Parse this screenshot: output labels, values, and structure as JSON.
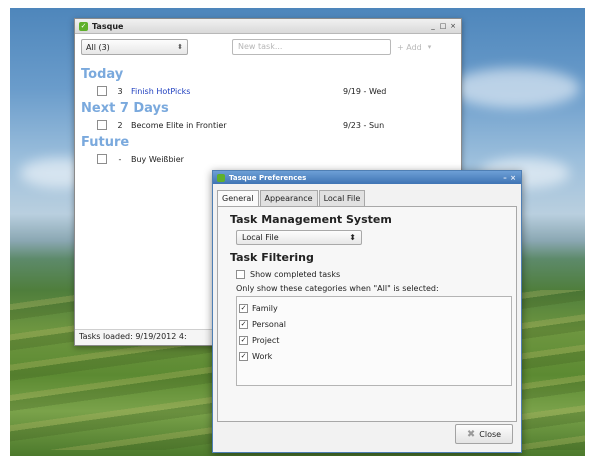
{
  "main_window": {
    "title": "Tasque",
    "controls": [
      "_",
      "□",
      "×"
    ],
    "filter_combo": "All (3)",
    "new_task_placeholder": "New task...",
    "add_label": "+ Add",
    "status": "Tasks loaded: 9/19/2012 4:"
  },
  "sections": [
    {
      "name": "Today",
      "tasks": [
        {
          "prio": "3",
          "name": "Finish HotPicks",
          "date": "9/19 - Wed"
        }
      ]
    },
    {
      "name": "Next 7 Days",
      "tasks": [
        {
          "prio": "2",
          "name": "Become Elite in Frontier",
          "date": "9/23 - Sun"
        }
      ]
    },
    {
      "name": "Future",
      "tasks": [
        {
          "prio": "-",
          "name": "Buy Weißbier",
          "date": ""
        }
      ]
    }
  ],
  "pref": {
    "title": "Tasque Preferences",
    "tabs": [
      "General",
      "Appearance",
      "Local File"
    ],
    "tms_heading": "Task Management System",
    "tms_value": "Local File",
    "filter_heading": "Task Filtering",
    "show_completed": "Show completed tasks",
    "categories_label": "Only show these categories when \"All\" is selected:",
    "categories": [
      "Family",
      "Personal",
      "Project",
      "Work"
    ],
    "close_label": "Close"
  }
}
